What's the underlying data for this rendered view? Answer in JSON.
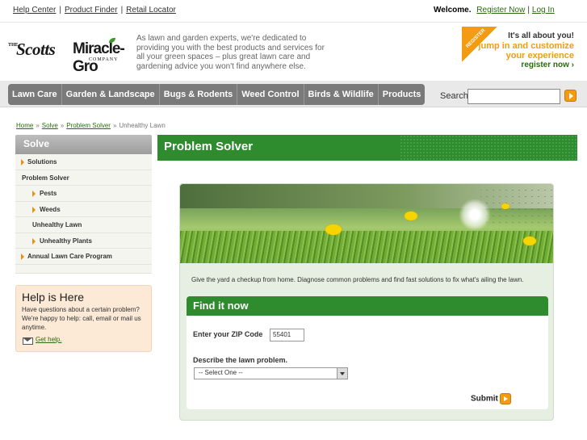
{
  "top": {
    "links": [
      "Help Center",
      "Product Finder",
      "Retail Locator"
    ],
    "welcome": "Welcome.",
    "register": "Register Now",
    "login": "Log In"
  },
  "brand": {
    "the": "THE",
    "scotts": "Scotts",
    "miracle_gro": "Miracle-Gro",
    "company": "COMPANY",
    "tagline": "As lawn and garden experts, we're dedicated to providing you with the best products and services for all your green spaces – plus great lawn care and gardening advice you won't find anywhere else."
  },
  "promo": {
    "ribbon": "REGISTER",
    "line1": "It's all about you!",
    "line2": "jump in and customize your experience",
    "line3": "register now ›"
  },
  "nav": {
    "items": [
      "Lawn Care",
      "Garden & Landscape",
      "Bugs & Rodents",
      "Weed Control",
      "Birds & Wildlife",
      "Products"
    ],
    "search_label": "Search"
  },
  "breadcrumb": {
    "items": [
      "Home",
      "Solve",
      "Problem Solver"
    ],
    "current": "Unhealthy Lawn"
  },
  "sidebar": {
    "heading": "Solve",
    "items": [
      "Solutions",
      "Problem Solver",
      "Pests",
      "Weeds",
      "Unhealthy Lawn",
      "Unhealthy Plants",
      "Annual Lawn Care Program"
    ]
  },
  "help": {
    "title": "Help is Here",
    "text": "Have questions about a certain problem? We're happy to help: call, email or mail us anytime.",
    "link": "Get help."
  },
  "main": {
    "title": "Problem Solver",
    "intro": "Give the yard a checkup from home. Diagnose common problems and find fast solutions to fix what's ailing the lawn.",
    "find": {
      "heading": "Find it now",
      "zip_label": "Enter your ZIP Code",
      "zip_value": "55401",
      "desc_label": "Describe the lawn problem.",
      "select_value": "-- Select One --",
      "submit_label": "Submit"
    }
  },
  "colors": {
    "accent_green": "#2e8b2e",
    "accent_orange": "#f39c12"
  }
}
